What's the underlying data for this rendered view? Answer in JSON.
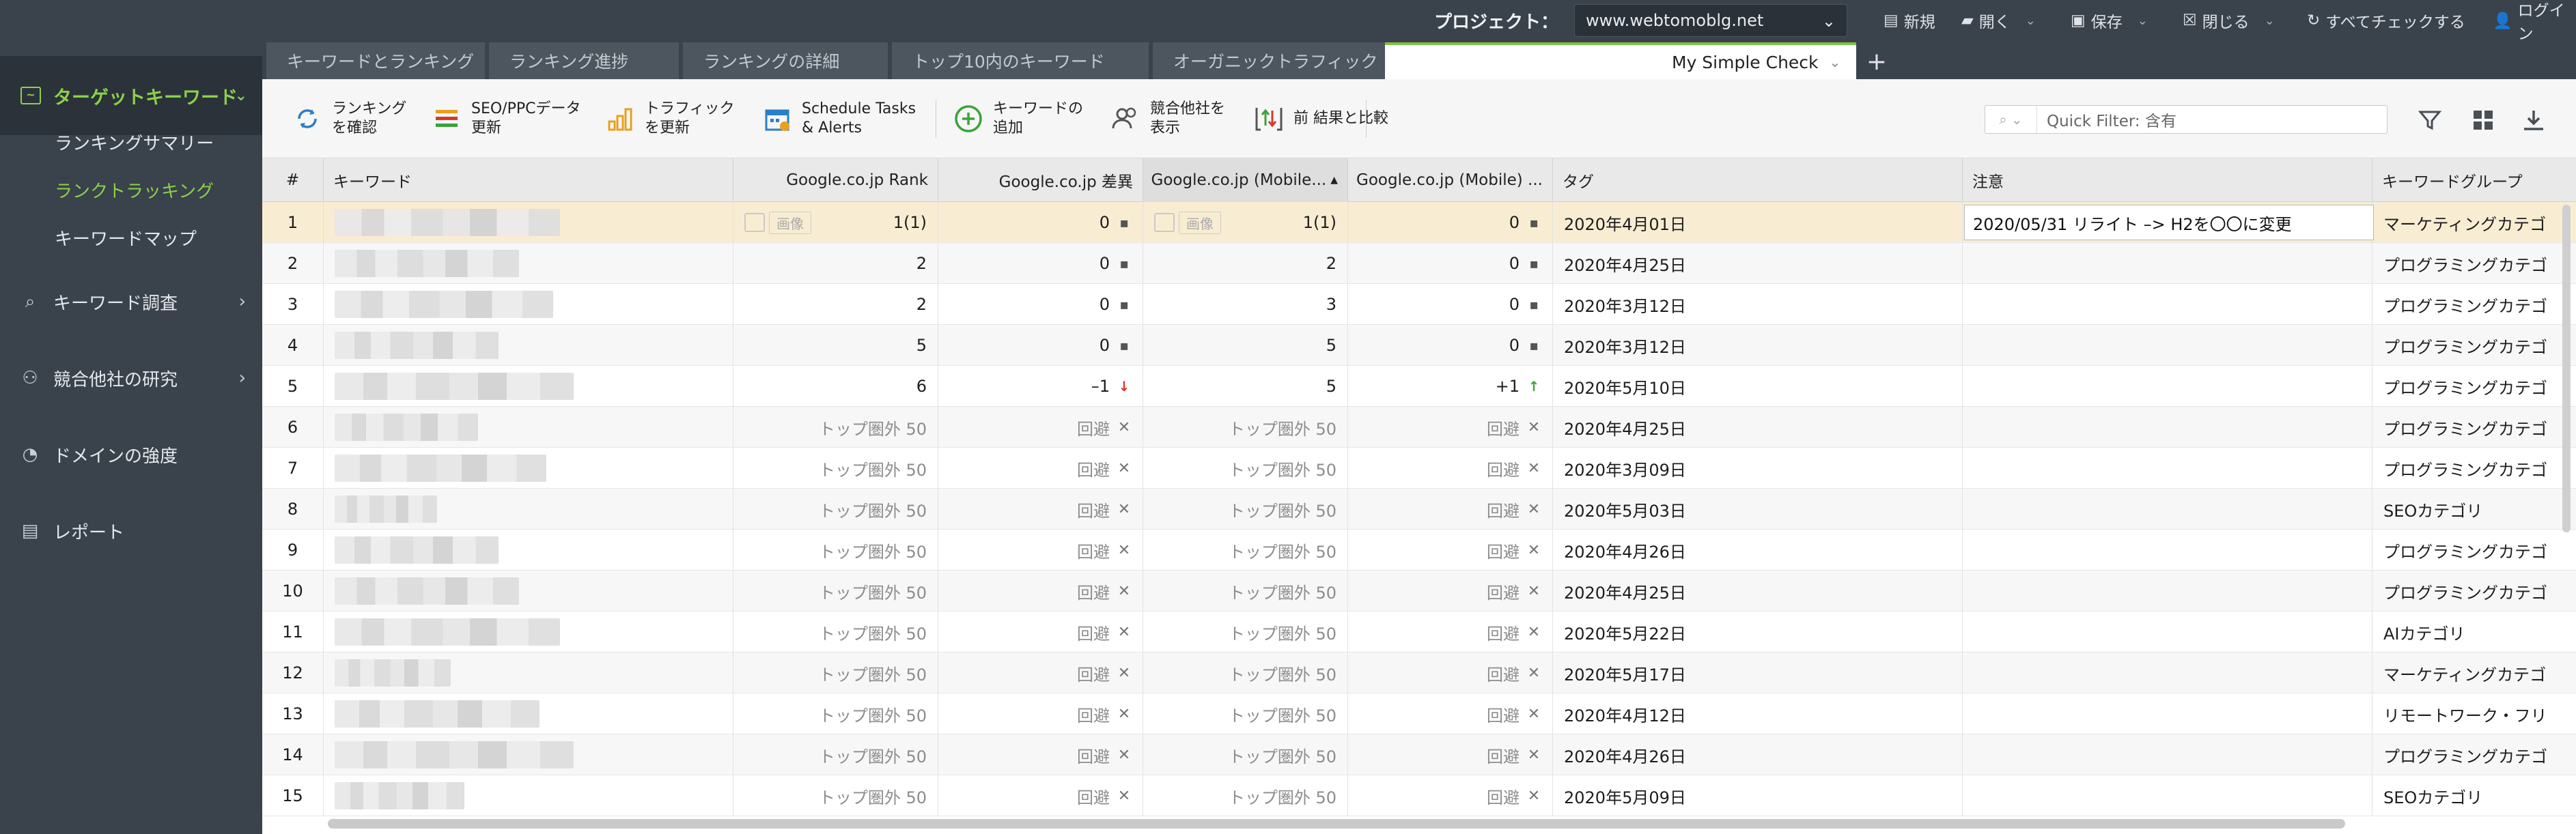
{
  "topbar": {
    "project_label": "プロジェクト：",
    "project_value": "www.webtomoblg.net",
    "new_label": "新規",
    "open_label": "開く",
    "save_label": "保存",
    "close_label": "閉じる",
    "check_all_label": "すべてチェックする",
    "login_label": "ログイン"
  },
  "sidebar": {
    "active_section": "ターゲットキーワード",
    "sub_items": [
      "ランキングサマリー",
      "ランクトラッキング",
      "キーワードマップ"
    ],
    "active_sub_index": 1,
    "sections": [
      "キーワード調査",
      "競合他社の研究",
      "ドメインの強度",
      "レポート"
    ]
  },
  "tabs": [
    "キーワードとランキング",
    "ランキング進捗",
    "ランキングの詳細",
    "トップ10内のキーワード",
    "オーガニックトラフィック（Google A...",
    "My Simple Check"
  ],
  "toolbar": {
    "check_rank": [
      "ランキング",
      "を確認"
    ],
    "seo_ppc": [
      "SEO/PPCデータ",
      "更新"
    ],
    "traffic": [
      "トラフィック",
      "を更新"
    ],
    "schedule": [
      "Schedule Tasks",
      "& Alerts"
    ],
    "add_keyword": [
      "キーワードの",
      "追加"
    ],
    "add_competitor": [
      "競合他社を",
      "表示"
    ],
    "compare": "前 結果と比較",
    "quick_filter_placeholder": "Quick Filter: 含有"
  },
  "table": {
    "headers": [
      "#",
      "キーワード",
      "Google.co.jp Rank",
      "Google.co.jp 差異",
      "Google.co.jp (Mobile...",
      "Google.co.jp (Mobile) ...",
      "タグ",
      "注意",
      "キーワードグループ"
    ],
    "image_label": "画像",
    "note_row1": "2020/05/31 リライト –> H2を〇〇に変更",
    "rows": [
      {
        "n": "1",
        "rank": "1(1)",
        "diff": "0",
        "diff_mark": "sq",
        "mrank": "1(1)",
        "mdiff": "0",
        "mdiff_mark": "sq",
        "tag": "2020年4月01日",
        "group": "マーケティングカテゴ",
        "img": true
      },
      {
        "n": "2",
        "rank": "2",
        "diff": "0",
        "diff_mark": "sq",
        "mrank": "2",
        "mdiff": "0",
        "mdiff_mark": "sq",
        "tag": "2020年4月25日",
        "group": "プログラミングカテゴ"
      },
      {
        "n": "3",
        "rank": "2",
        "diff": "0",
        "diff_mark": "sq",
        "mrank": "3",
        "mdiff": "0",
        "mdiff_mark": "sq",
        "tag": "2020年3月12日",
        "group": "プログラミングカテゴ"
      },
      {
        "n": "4",
        "rank": "5",
        "diff": "0",
        "diff_mark": "sq",
        "mrank": "5",
        "mdiff": "0",
        "mdiff_mark": "sq",
        "tag": "2020年3月12日",
        "group": "プログラミングカテゴ"
      },
      {
        "n": "5",
        "rank": "6",
        "diff": "–1",
        "diff_mark": "dn",
        "mrank": "5",
        "mdiff": "+1",
        "mdiff_mark": "up",
        "tag": "2020年5月10日",
        "group": "プログラミングカテゴ"
      },
      {
        "n": "6",
        "rank": "トップ圏外 50",
        "diff": "回避",
        "diff_mark": "x",
        "mrank": "トップ圏外 50",
        "mdiff": "回避",
        "mdiff_mark": "x",
        "tag": "2020年4月25日",
        "group": "プログラミングカテゴ",
        "muted": true
      },
      {
        "n": "7",
        "rank": "トップ圏外 50",
        "diff": "回避",
        "diff_mark": "x",
        "mrank": "トップ圏外 50",
        "mdiff": "回避",
        "mdiff_mark": "x",
        "tag": "2020年3月09日",
        "group": "プログラミングカテゴ",
        "muted": true
      },
      {
        "n": "8",
        "rank": "トップ圏外 50",
        "diff": "回避",
        "diff_mark": "x",
        "mrank": "トップ圏外 50",
        "mdiff": "回避",
        "mdiff_mark": "x",
        "tag": "2020年5月03日",
        "group": "SEOカテゴリ",
        "muted": true
      },
      {
        "n": "9",
        "rank": "トップ圏外 50",
        "diff": "回避",
        "diff_mark": "x",
        "mrank": "トップ圏外 50",
        "mdiff": "回避",
        "mdiff_mark": "x",
        "tag": "2020年4月26日",
        "group": "プログラミングカテゴ",
        "muted": true
      },
      {
        "n": "10",
        "rank": "トップ圏外 50",
        "diff": "回避",
        "diff_mark": "x",
        "mrank": "トップ圏外 50",
        "mdiff": "回避",
        "mdiff_mark": "x",
        "tag": "2020年4月25日",
        "group": "プログラミングカテゴ",
        "muted": true
      },
      {
        "n": "11",
        "rank": "トップ圏外 50",
        "diff": "回避",
        "diff_mark": "x",
        "mrank": "トップ圏外 50",
        "mdiff": "回避",
        "mdiff_mark": "x",
        "tag": "2020年5月22日",
        "group": "AIカテゴリ",
        "muted": true
      },
      {
        "n": "12",
        "rank": "トップ圏外 50",
        "diff": "回避",
        "diff_mark": "x",
        "mrank": "トップ圏外 50",
        "mdiff": "回避",
        "mdiff_mark": "x",
        "tag": "2020年5月17日",
        "group": "マーケティングカテゴ",
        "muted": true
      },
      {
        "n": "13",
        "rank": "トップ圏外 50",
        "diff": "回避",
        "diff_mark": "x",
        "mrank": "トップ圏外 50",
        "mdiff": "回避",
        "mdiff_mark": "x",
        "tag": "2020年4月12日",
        "group": "リモートワーク・フリ",
        "muted": true
      },
      {
        "n": "14",
        "rank": "トップ圏外 50",
        "diff": "回避",
        "diff_mark": "x",
        "mrank": "トップ圏外 50",
        "mdiff": "回避",
        "mdiff_mark": "x",
        "tag": "2020年4月26日",
        "group": "プログラミングカテゴ",
        "muted": true
      },
      {
        "n": "15",
        "rank": "トップ圏外 50",
        "diff": "回避",
        "diff_mark": "x",
        "mrank": "トップ圏外 50",
        "mdiff": "回避",
        "mdiff_mark": "x",
        "tag": "2020年5月09日",
        "group": "SEOカテゴリ",
        "muted": true
      }
    ]
  },
  "colors": {
    "accent_green": "#8bd14a",
    "chrome_dark": "#3a424c",
    "selected_row": "#f8edd3",
    "down_red": "#e0332b",
    "up_green": "#3aa33a"
  }
}
